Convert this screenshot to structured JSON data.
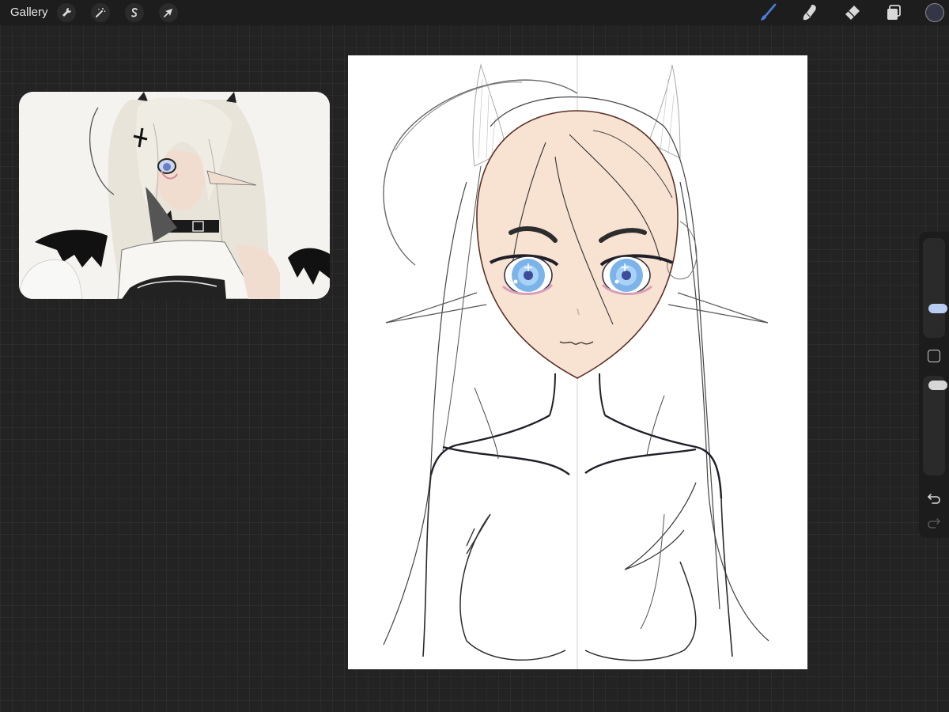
{
  "app": {
    "gallery_label": "Gallery",
    "accent_color": "#4a7fd9",
    "current_color": "#353548"
  },
  "toolbar_left": [
    {
      "name": "actions-button",
      "icon": "wrench-icon"
    },
    {
      "name": "adjustments-button",
      "icon": "magic-wand-icon"
    },
    {
      "name": "selection-button",
      "icon": "selection-s-icon"
    },
    {
      "name": "transform-button",
      "icon": "arrow-cursor-icon"
    }
  ],
  "toolbar_right": [
    {
      "name": "brush-tool",
      "icon": "paintbrush-icon",
      "active": true
    },
    {
      "name": "smudge-tool",
      "icon": "smudge-finger-icon",
      "active": false
    },
    {
      "name": "eraser-tool",
      "icon": "eraser-icon",
      "active": false
    },
    {
      "name": "layers-button",
      "icon": "layers-icon",
      "active": false
    }
  ],
  "sidebar": {
    "brush_size": 0.25,
    "brush_opacity": 0.95,
    "icons": [
      "undo-icon",
      "redo-icon",
      "square-modify-icon"
    ]
  },
  "reference_window": {
    "content": "reference-image"
  },
  "canvas": {
    "content": "line-art-sketch"
  }
}
